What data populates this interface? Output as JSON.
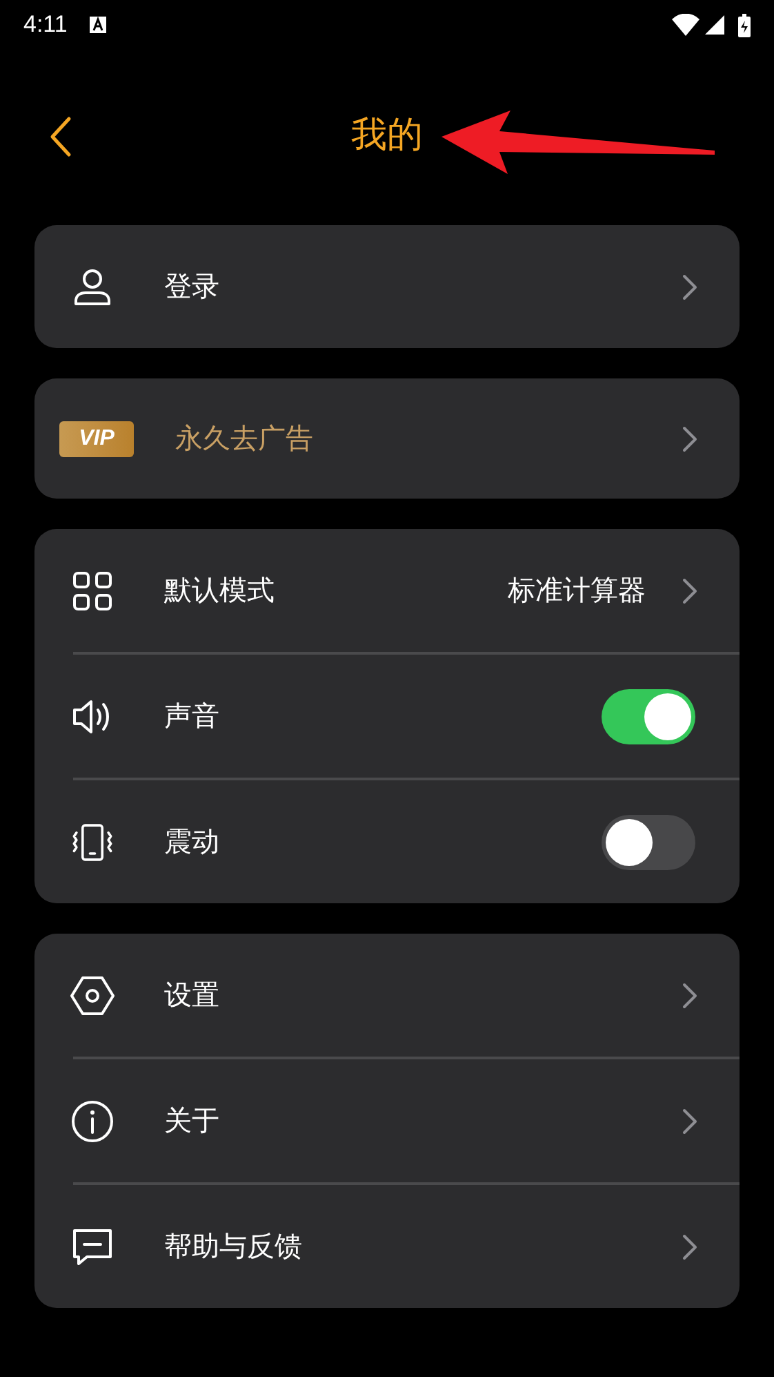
{
  "status_bar": {
    "time": "4:11"
  },
  "header": {
    "title": "我的"
  },
  "groups": [
    {
      "rows": [
        {
          "kind": "link",
          "label": "登录"
        }
      ]
    },
    {
      "rows": [
        {
          "kind": "vip",
          "badge": "VIP",
          "label": "永久去广告"
        }
      ]
    },
    {
      "rows": [
        {
          "kind": "link",
          "label": "默认模式",
          "value": "标准计算器"
        },
        {
          "kind": "toggle",
          "label": "声音",
          "on": true
        },
        {
          "kind": "toggle",
          "label": "震动",
          "on": false
        }
      ]
    },
    {
      "rows": [
        {
          "kind": "link",
          "label": "设置"
        },
        {
          "kind": "link",
          "label": "关于"
        },
        {
          "kind": "link",
          "label": "帮助与反馈"
        }
      ]
    }
  ]
}
